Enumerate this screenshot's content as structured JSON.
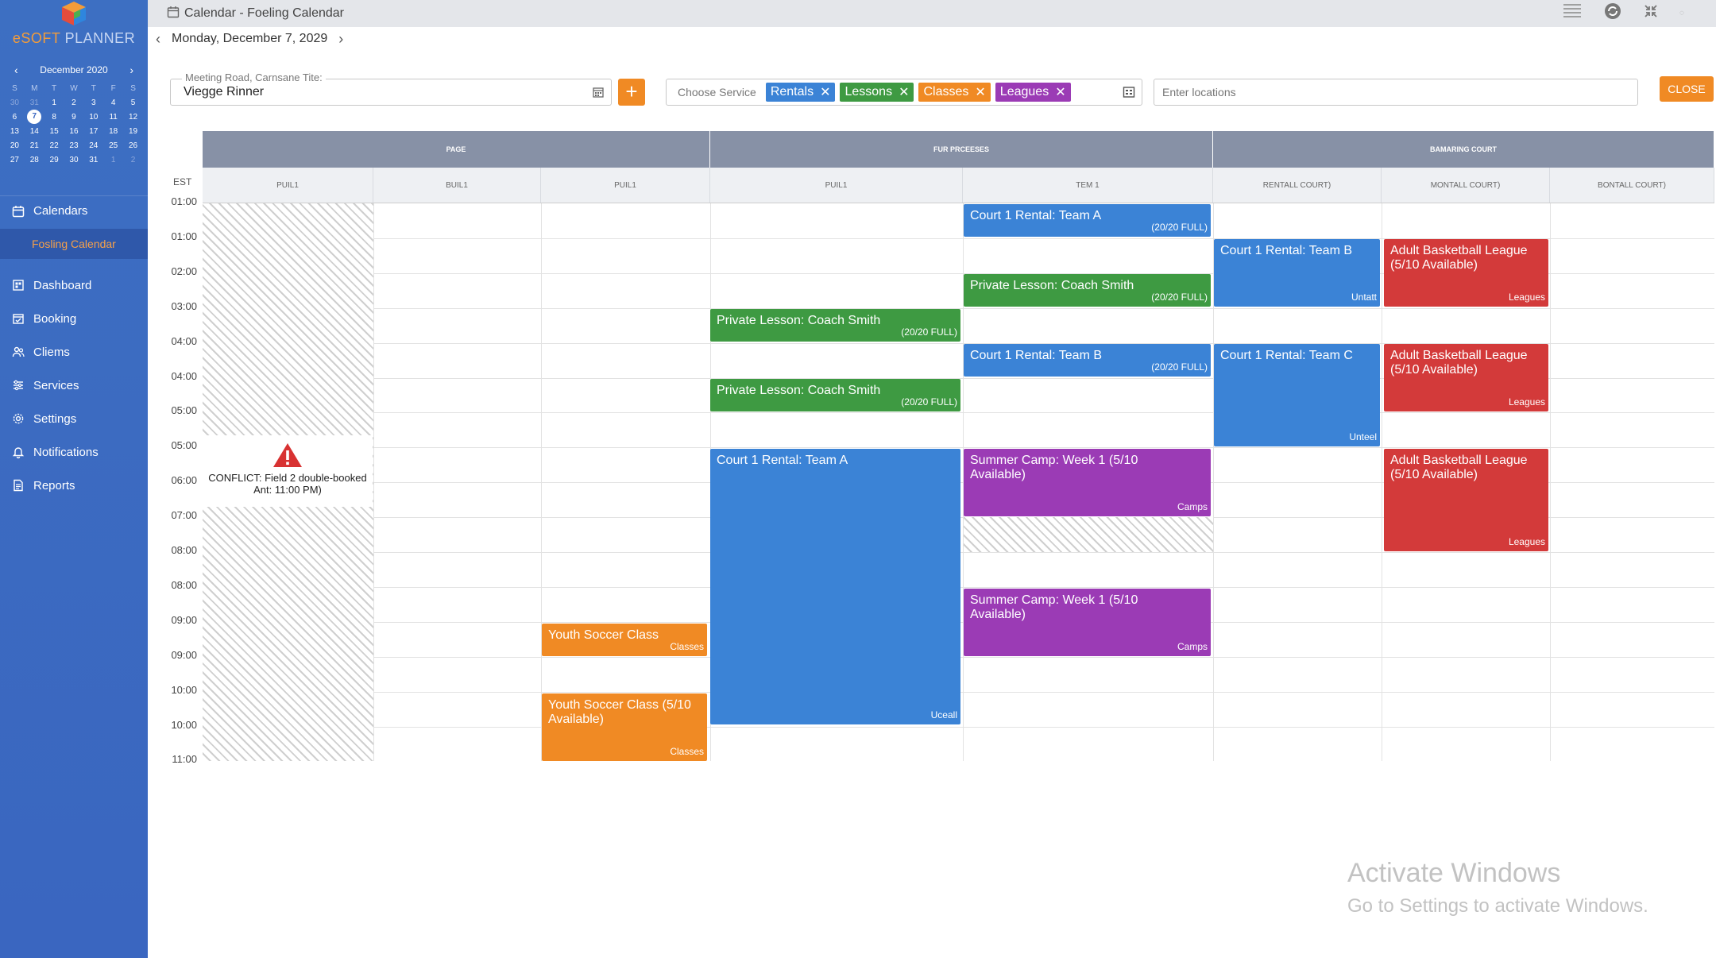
{
  "window": {
    "title": "Calendar - Foeling Calendar"
  },
  "brand": {
    "e": "e",
    "soft": "SOFT",
    "planner": "PLANNER"
  },
  "mini_calendar": {
    "month": "December 2020",
    "weekdays": [
      "S",
      "M",
      "T",
      "W",
      "T",
      "F",
      "S"
    ],
    "weeks": [
      [
        "30",
        "31",
        "1",
        "2",
        "3",
        "4",
        "5"
      ],
      [
        "6",
        "7",
        "8",
        "9",
        "10",
        "11",
        "12"
      ],
      [
        "13",
        "14",
        "15",
        "16",
        "17",
        "18",
        "19"
      ],
      [
        "20",
        "21",
        "22",
        "23",
        "24",
        "25",
        "26"
      ],
      [
        "27",
        "28",
        "29",
        "30",
        "31",
        "1",
        "2"
      ]
    ],
    "today": "7"
  },
  "sidebar": {
    "calendars_label": "Calendars",
    "active_calendar": "Fosling Calendar",
    "items": [
      {
        "label": "Dashboard",
        "icon": "dashboard-icon"
      },
      {
        "label": "Booking",
        "icon": "booking-icon"
      },
      {
        "label": "Cliems",
        "icon": "clients-icon"
      },
      {
        "label": "Services",
        "icon": "services-icon"
      },
      {
        "label": "Settings",
        "icon": "settings-icon"
      },
      {
        "label": "Notifications",
        "icon": "bell-icon"
      },
      {
        "label": "Reports",
        "icon": "reports-icon"
      }
    ]
  },
  "date_nav": {
    "label": "Monday, December 7, 2029"
  },
  "filters": {
    "location_label": "Meeting Road, Carnsane Tite:",
    "location_value": "Viegge Rinner",
    "service_placeholder": "Choose Service",
    "chips": [
      {
        "label": "Rentals",
        "color": "#3b83d6"
      },
      {
        "label": "Lessons",
        "color": "#3e9a42"
      },
      {
        "label": "Classes",
        "color": "#f08a24"
      },
      {
        "label": "Leagues",
        "color": "#9b3bb5"
      }
    ],
    "locations_placeholder": "Enter locations",
    "close_label": "CLOSE"
  },
  "grid": {
    "timezone": "EST",
    "groups": [
      "PAGE",
      "FUR PRCEESES",
      "BAMARING COURT"
    ],
    "columns": [
      "PUIL1",
      "BUIL1",
      "PUIL1",
      "PUIL1",
      "TEM 1",
      "RENTALL COURT)",
      "MONTALL COURT)",
      "BONTALL COURT)"
    ],
    "times": [
      "01:00",
      "01:00",
      "02:00",
      "03:00",
      "04:00",
      "04:00",
      "05:00",
      "05:00",
      "06:00",
      "07:00",
      "08:00",
      "08:00",
      "09:00",
      "09:00",
      "10:00",
      "10:00",
      "11:00"
    ]
  },
  "conflict": {
    "line1": "CONFLICT: Field 2 double-booked",
    "line2": "Ant: 11:00 PM)"
  },
  "events": [
    {
      "title": "Court 1 Rental: Team A",
      "tag": "(20/20 FULL)"
    },
    {
      "title": "Court 1 Rental: Team B",
      "tag": "Untatt"
    },
    {
      "title": "Adult Basketball League (5/10 Available)",
      "tag": "Leagues"
    },
    {
      "title": "Private Lesson: Coach Smith",
      "tag": "(20/20 FULL)"
    },
    {
      "title": "Private Lesson: Coach Smith",
      "tag": "(20/20 FULL)"
    },
    {
      "title": "Court 1 Rental: Team B",
      "tag": "(20/20 FULL)"
    },
    {
      "title": "Court 1 Rental: Team C",
      "tag": "Unteel"
    },
    {
      "title": "Adult Basketball League (5/10 Available)",
      "tag": "Leagues"
    },
    {
      "title": "Private Lesson: Coach Smith",
      "tag": "(20/20 FULL)"
    },
    {
      "title": "Court 1 Rental: Team A",
      "tag": "Uceall"
    },
    {
      "title": "Summer Camp: Week 1 (5/10 Available)",
      "tag": "Camps"
    },
    {
      "title": "Adult Basketball League (5/10 Available)",
      "tag": "Leagues"
    },
    {
      "title": "Summer Camp: Week 1 (5/10 Available)",
      "tag": "Camps"
    },
    {
      "title": "Youth Soccer Class",
      "tag": "Classes"
    },
    {
      "title": "Youth Soccer Class (5/10 Available)",
      "tag": "Classes"
    }
  ],
  "watermark": {
    "line1": "Activate Windows",
    "line2": "Go to Settings to activate Windows."
  }
}
